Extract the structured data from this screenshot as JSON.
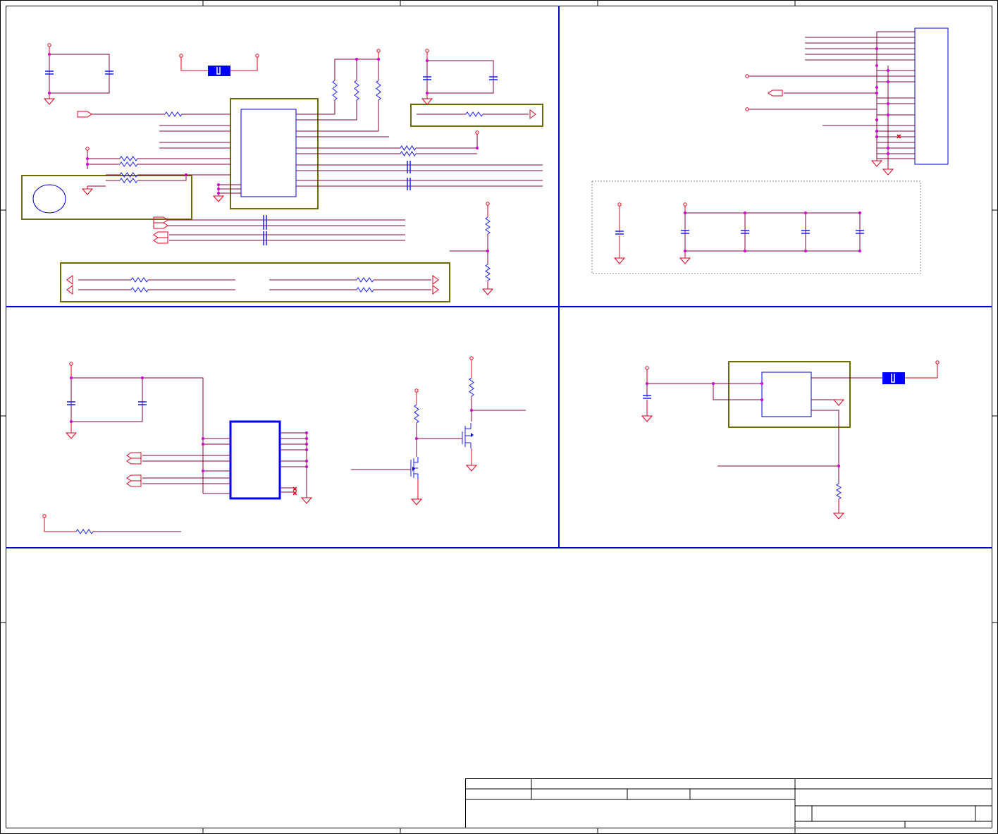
{
  "sheet": {
    "title": "",
    "palette": {
      "wire": "#800040",
      "net": "#e0001c",
      "resistor": "#1a1aff",
      "capacitor": "#1a1aff",
      "border": "#0000cc",
      "group_box": "#6b6b00",
      "junction": "#cc00cc",
      "frame": "#000000",
      "fill_part": "#0000ff"
    }
  },
  "title_block": {
    "cells": [
      "",
      "",
      "",
      "",
      "",
      "",
      ""
    ]
  }
}
